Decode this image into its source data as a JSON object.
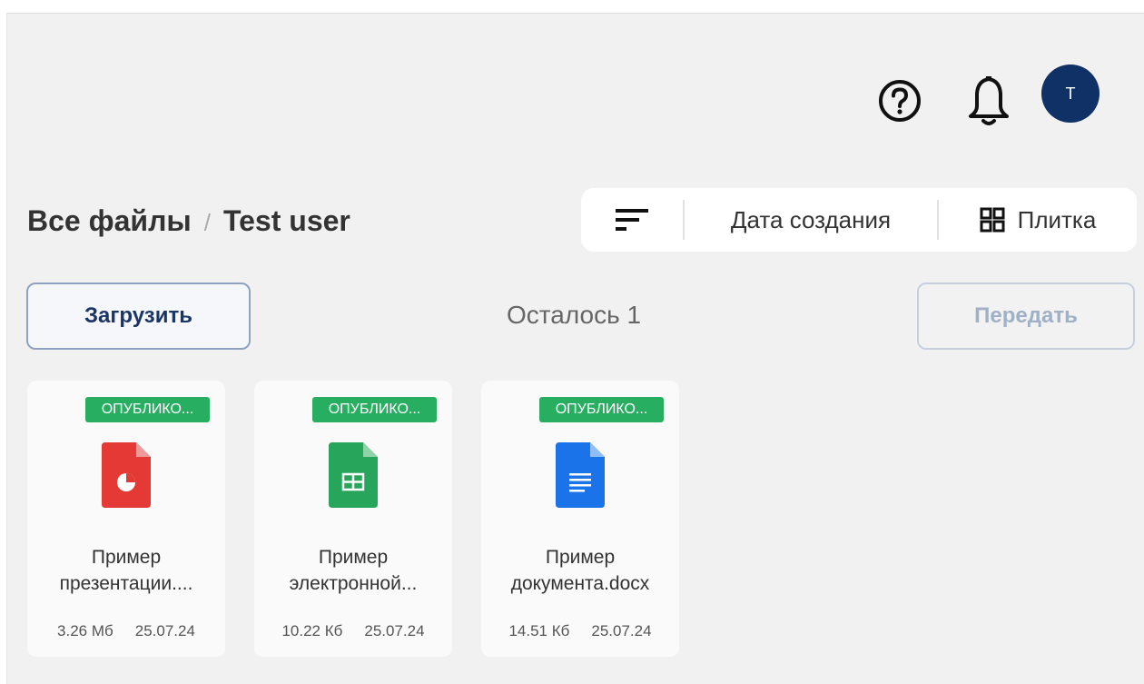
{
  "header": {
    "help_icon": "question-circle-icon",
    "bell_icon": "bell-icon",
    "avatar_initial": "T",
    "avatar_color": "#0f3166"
  },
  "breadcrumb": {
    "root": "Все файлы",
    "separator": "/",
    "current": "Test user"
  },
  "toolbar": {
    "sort_icon": "sort-lines-icon",
    "sort_field": "Дата создания",
    "view_icon": "grid-icon",
    "view_mode": "Плитка"
  },
  "actions": {
    "upload_label": "Загрузить",
    "remaining": "Осталось 1",
    "transfer_label": "Передать"
  },
  "files": [
    {
      "badge": "ОПУБЛИКО...",
      "name_line1": "Пример",
      "name_line2": "презентации....",
      "size": "3.26 Мб",
      "date": "25.07.24",
      "icon": "presentation-file-icon",
      "color": "#e53935"
    },
    {
      "badge": "ОПУБЛИКО...",
      "name_line1": "Пример",
      "name_line2": "электронной...",
      "size": "10.22 Кб",
      "date": "25.07.24",
      "icon": "spreadsheet-file-icon",
      "color": "#27a55a"
    },
    {
      "badge": "ОПУБЛИКО...",
      "name_line1": "Пример",
      "name_line2": "документа.docx",
      "size": "14.51 Кб",
      "date": "25.07.24",
      "icon": "document-file-icon",
      "color": "#1a73e8"
    }
  ],
  "colors": {
    "badge_green": "#27ae60",
    "brand_navy": "#0f3166"
  }
}
